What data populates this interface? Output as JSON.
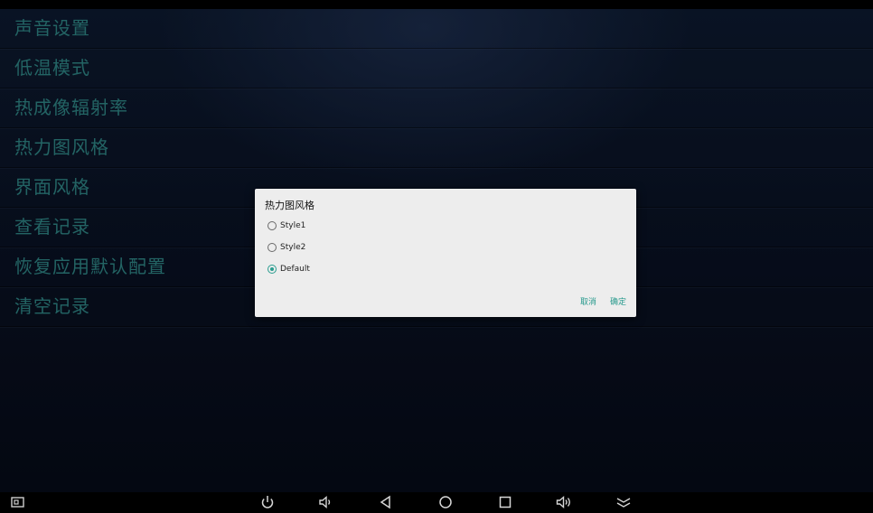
{
  "menu": {
    "items": [
      {
        "label": "声音设置"
      },
      {
        "label": "低温模式"
      },
      {
        "label": "热成像辐射率"
      },
      {
        "label": "热力图风格"
      },
      {
        "label": "界面风格"
      },
      {
        "label": "查看记录"
      },
      {
        "label": "恢复应用默认配置"
      },
      {
        "label": "清空记录"
      }
    ]
  },
  "dialog": {
    "title": "热力图风格",
    "options": [
      {
        "label": "Style1",
        "checked": false
      },
      {
        "label": "Style2",
        "checked": false
      },
      {
        "label": "Default",
        "checked": true
      }
    ],
    "cancel_label": "取消",
    "confirm_label": "确定"
  },
  "navbar": {
    "icons": [
      "screenshot-icon",
      "power-icon",
      "volume-down-icon",
      "back-icon",
      "home-icon",
      "recents-icon",
      "volume-up-icon",
      "hide-bar-icon"
    ]
  },
  "colors": {
    "menu_text": "#2f8686",
    "accent": "#26998c",
    "dialog_bg": "#ededed",
    "background": "#0a1326"
  }
}
